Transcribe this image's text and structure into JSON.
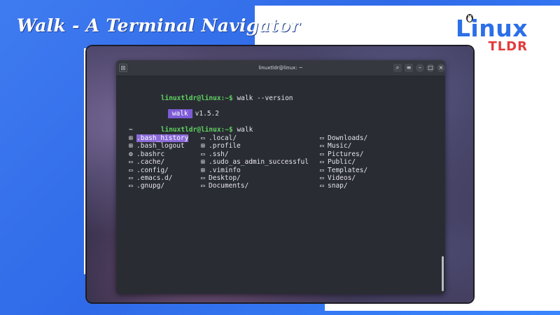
{
  "banner": {
    "headline": "Walk - A Terminal Navigator",
    "logo_primary": "Linux",
    "logo_secondary": "TLDR"
  },
  "window": {
    "title": "linuxtldr@linux: ~",
    "buttons": [
      "search-icon",
      "menu-icon",
      "minimize-icon",
      "maximize-icon",
      "close-icon"
    ]
  },
  "terminal": {
    "prompt": "linuxtldr@linux:~$",
    "commands": [
      {
        "cmd": " walk --version"
      },
      {
        "cmd": " walk"
      }
    ],
    "version_badge": "walk",
    "version_value": "v1.5.2",
    "cwd_marker": "~",
    "columns": [
      [
        {
          "icon": "file-icon",
          "name": ".bash_history",
          "selected": true
        },
        {
          "icon": "file-icon",
          "name": ".bash_logout"
        },
        {
          "icon": "gear-icon",
          "name": ".bashrc"
        },
        {
          "icon": "folder-icon",
          "name": ".cache/"
        },
        {
          "icon": "folder-icon",
          "name": ".config/"
        },
        {
          "icon": "folder-icon",
          "name": ".emacs.d/"
        },
        {
          "icon": "folder-icon",
          "name": ".gnupg/"
        }
      ],
      [
        {
          "icon": "folder-icon",
          "name": ".local/"
        },
        {
          "icon": "file-icon",
          "name": ".profile"
        },
        {
          "icon": "folder-icon",
          "name": ".ssh/"
        },
        {
          "icon": "file-icon",
          "name": ".sudo_as_admin_successful"
        },
        {
          "icon": "file-icon",
          "name": ".viminfo"
        },
        {
          "icon": "folder-icon",
          "name": "Desktop/"
        },
        {
          "icon": "folder-icon",
          "name": "Documents/"
        }
      ],
      [
        {
          "icon": "folder-icon",
          "name": "Downloads/"
        },
        {
          "icon": "folder-icon",
          "name": "Music/"
        },
        {
          "icon": "folder-icon",
          "name": "Pictures/"
        },
        {
          "icon": "folder-icon",
          "name": "Public/"
        },
        {
          "icon": "folder-icon",
          "name": "Templates/"
        },
        {
          "icon": "folder-icon",
          "name": "Videos/"
        },
        {
          "icon": "folder-icon",
          "name": "snap/"
        }
      ]
    ]
  },
  "colors": {
    "prompt": "#5fd35f",
    "badge": "#7d5bd6",
    "selection": "#8b6ad8",
    "brand_blue": "#2c6fe8",
    "brand_red": "#e23b3b"
  }
}
